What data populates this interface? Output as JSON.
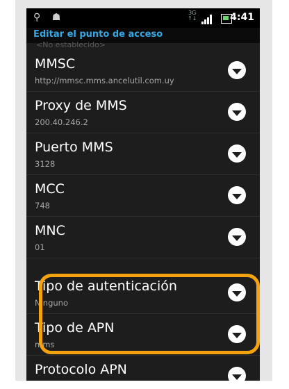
{
  "status_bar": {
    "left_icons": [
      "usb-icon",
      "android-icon"
    ],
    "network": "3G",
    "time": "4:41"
  },
  "title": "Editar el punto de acceso",
  "ghost_text": "<No establecido>",
  "settings": [
    {
      "label": "MMSC",
      "value": "http://mmsc.mms.ancelutil.com.uy"
    },
    {
      "label": "Proxy de MMS",
      "value": "200.40.246.2"
    },
    {
      "label": "Puerto MMS",
      "value": "3128"
    },
    {
      "label": "MCC",
      "value": "748"
    },
    {
      "label": "MNC",
      "value": "01"
    },
    {
      "label": "Tipo de autenticación",
      "value": "Ninguno"
    },
    {
      "label": "Tipo de APN",
      "value": "mms"
    },
    {
      "label": "Protocolo APN",
      "value": ""
    }
  ],
  "highlight_color": "#f2a30f",
  "accent_color": "#35a7e3"
}
